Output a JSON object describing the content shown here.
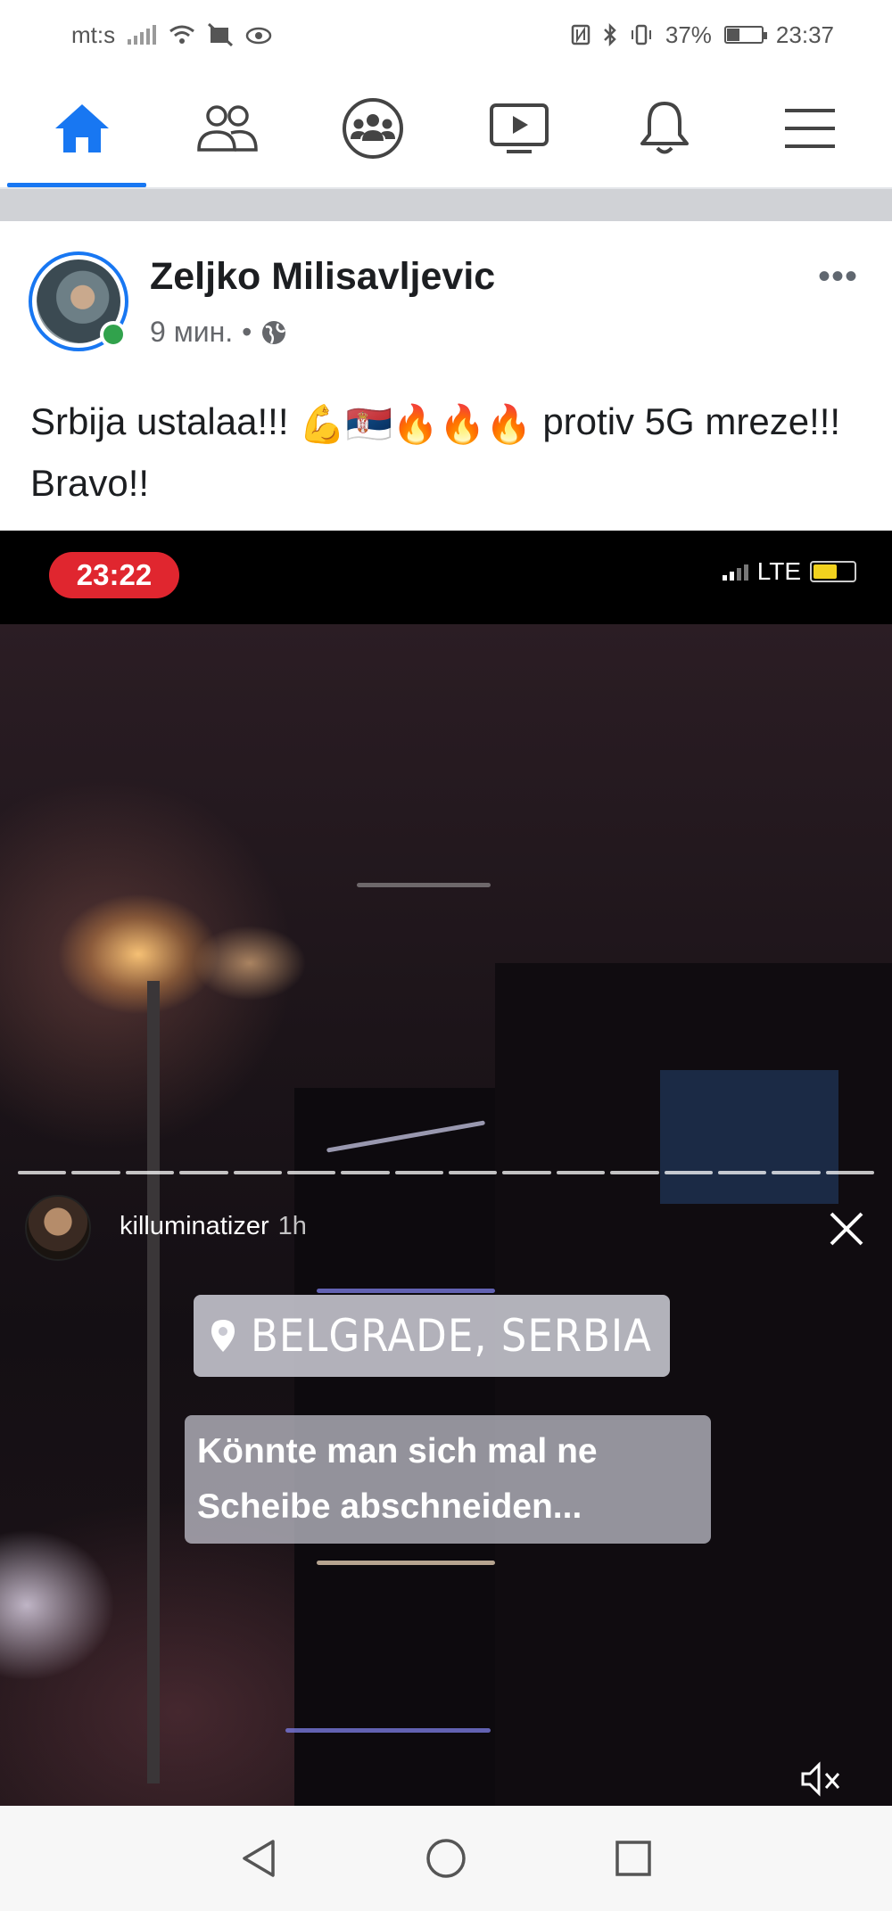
{
  "status_bar": {
    "carrier": "mt:s",
    "battery_percent": "37%",
    "battery_level": 0.37,
    "time": "23:37",
    "icons": [
      "signal-icon",
      "wifi-icon",
      "no-notifications-icon",
      "eye-icon",
      "nfc-icon",
      "bluetooth-icon",
      "vibrate-icon",
      "battery-icon"
    ]
  },
  "fb_nav": {
    "items": [
      {
        "name": "home",
        "icon": "home-icon",
        "active": true
      },
      {
        "name": "friends",
        "icon": "friends-icon",
        "active": false
      },
      {
        "name": "groups",
        "icon": "groups-icon",
        "active": false
      },
      {
        "name": "watch",
        "icon": "video-icon",
        "active": false
      },
      {
        "name": "notifications",
        "icon": "bell-icon",
        "active": false
      },
      {
        "name": "menu",
        "icon": "hamburger-icon",
        "active": false
      }
    ],
    "accent_color": "#1877f2"
  },
  "post": {
    "author": "Zeljko Milisavljevic",
    "time": "9 мин.",
    "separator": "•",
    "privacy_icon": "globe-icon",
    "online": true,
    "more_label": "•••",
    "text_before": "Srbija ustalaa!!!",
    "emojis": "💪🇷🇸🔥🔥🔥",
    "text_after": "protiv 5G mreze!!! Bravo!!"
  },
  "story": {
    "phone_clock": "23:22",
    "network": "LTE",
    "username": "killuminatizer",
    "age": "1h",
    "location": "BELGRADE, SERBIA",
    "caption": "Könnte man sich mal ne Scheibe abschneiden...",
    "segment_count": 16,
    "recording_color": "#e0262f"
  },
  "android_nav": {
    "buttons": [
      "back-icon",
      "home-circle-icon",
      "recents-icon"
    ]
  }
}
